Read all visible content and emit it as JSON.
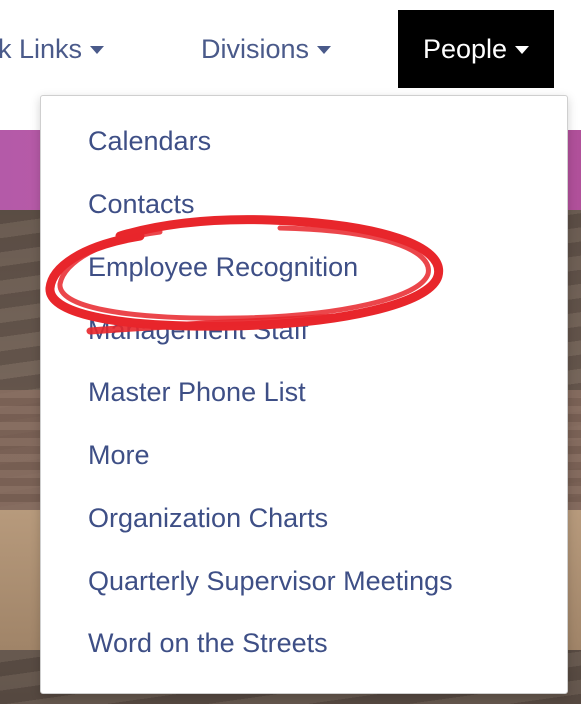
{
  "nav": {
    "quick_links": "k Links",
    "divisions": "Divisions",
    "people": "People"
  },
  "dropdown": {
    "items": [
      "Calendars",
      "Contacts",
      "Employee Recognition",
      "Management Staff",
      "Master Phone List",
      "More",
      "Organization Charts",
      "Quarterly Supervisor Meetings",
      "Word on the Streets"
    ]
  },
  "colors": {
    "link": "#3e4f86",
    "active_nav_bg": "#000000",
    "annotation": "#e8262b",
    "hero_band": "#b45aa8"
  },
  "icons": [
    "caret-down-icon"
  ]
}
